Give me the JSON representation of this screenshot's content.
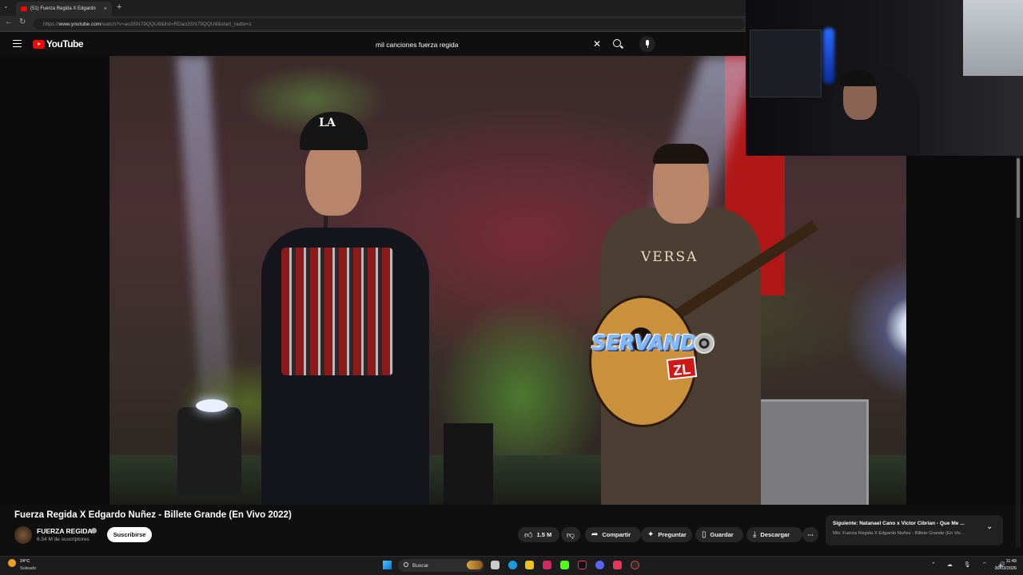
{
  "browser": {
    "tab_title": "(51) Fuerza Regida X Edgardo",
    "tab_close": "×",
    "new_tab": "+",
    "url_prefix": "https://",
    "url_host": "www.youtube.com",
    "url_path": "/watch?v=ao3SN79QQU8&list=RDao3SN79QQU8&start_radio=1"
  },
  "youtube": {
    "logo_text": "YouTube",
    "search_query": "mil canciones fuerza regida",
    "search_clear": "✕"
  },
  "video": {
    "watermark_text": "SERVANDO",
    "watermark_badge": "ZL",
    "shirt_text": "VERSA",
    "cap_logo": "LA",
    "title": "Fuerza Regida X Edgardo Nuñez - Billete Grande (En Vivo 2022)",
    "channel_name": "FUERZA REGIDA",
    "subscribers": "6.54 M de suscriptores",
    "subscribe_label": "Suscribirse",
    "actions": {
      "likes": "1.5 M",
      "share": "Compartir",
      "ask": "Preguntar",
      "save": "Guardar",
      "download": "Descargar",
      "more": "⋯"
    }
  },
  "up_next": {
    "title": "Siguiente: Natanael Cano x Victor Cibrian - Que Me ...",
    "subtitle": "Mix: Fuerza Regida X Edgardo Nuñez - Billete Grande (En Viv...",
    "chevron": "⌄"
  },
  "taskbar": {
    "weather_temp": "24°C",
    "weather_desc": "Soleado",
    "search_label": "Buscar",
    "tray_icons": "⌃ ☁ 🎙 ⌔ 🔊",
    "time": "11:49",
    "date": "30/03/2026"
  },
  "colors": {
    "youtube_red": "#ff0000",
    "background": "#0f0f0f",
    "button_bg": "#272727",
    "watermark_red": "#d01818"
  }
}
